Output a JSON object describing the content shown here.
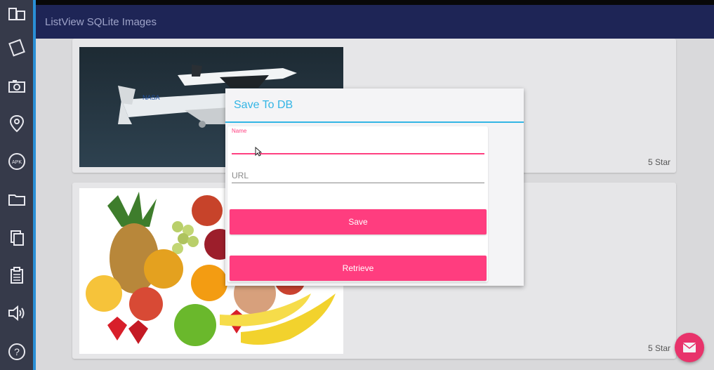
{
  "app": {
    "title": "ListView SQLite Images"
  },
  "sidebar": {
    "items": [
      {
        "icon": "rotate-device-icon"
      },
      {
        "icon": "tilt-device-icon"
      },
      {
        "icon": "camera-icon"
      },
      {
        "icon": "location-pin-icon"
      },
      {
        "icon": "apk-icon",
        "label": "APK"
      },
      {
        "icon": "folder-icon"
      },
      {
        "icon": "copy-icon"
      },
      {
        "icon": "clipboard-icon"
      },
      {
        "icon": "volume-icon"
      },
      {
        "icon": "help-icon",
        "label": "?"
      }
    ]
  },
  "list": {
    "items": [
      {
        "image": "space-shuttle-photo",
        "rating": "5 Star"
      },
      {
        "image": "fruits-photo",
        "rating": "5 Star"
      }
    ]
  },
  "dialog": {
    "title": "Save To DB",
    "name_label": "Name",
    "name_value": "",
    "url_placeholder": "URL",
    "url_value": "",
    "save_label": "Save",
    "retrieve_label": "Retrieve"
  },
  "fab": {
    "icon": "mail-icon"
  },
  "colors": {
    "app_bar": "#1e2556",
    "accent_pink": "#ff3d7f",
    "dialog_title": "#33b5e5",
    "sidebar": "#363a4a"
  }
}
